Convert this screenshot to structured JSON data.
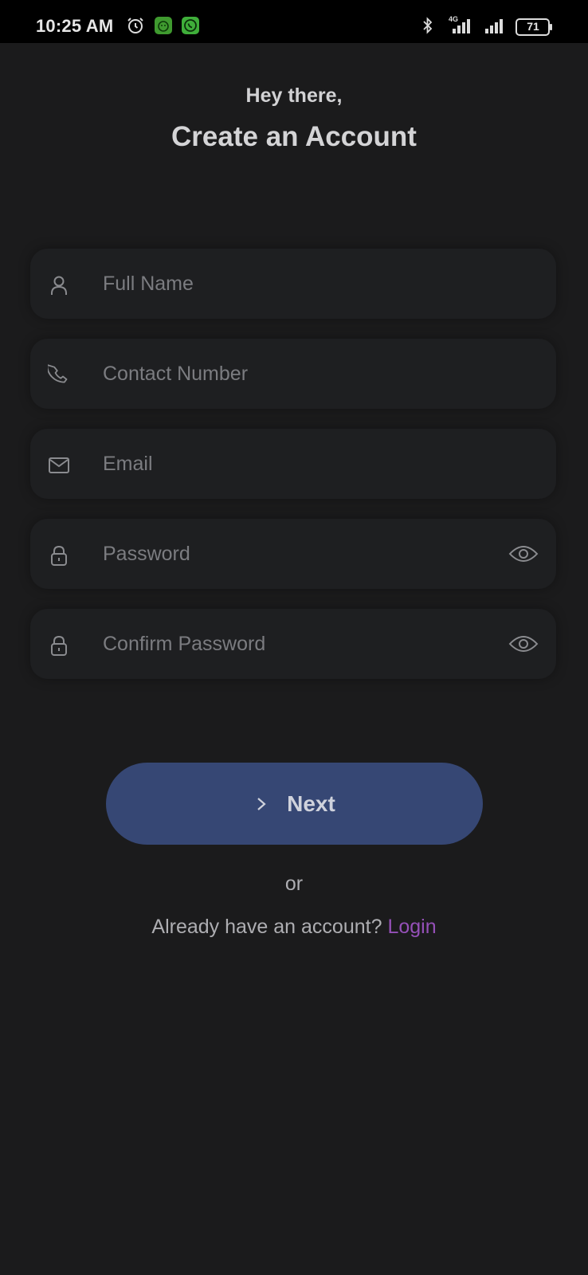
{
  "status_bar": {
    "time": "10:25 AM",
    "network": "4G",
    "battery": "71",
    "icons": [
      "alarm-icon",
      "app-notification-icon",
      "whatsapp-icon",
      "bluetooth-icon",
      "signal-icon",
      "signal-icon",
      "battery-icon"
    ]
  },
  "header": {
    "greeting": "Hey there,",
    "title": "Create an Account"
  },
  "form": {
    "full_name": {
      "placeholder": "Full Name",
      "icon": "person-icon"
    },
    "contact_number": {
      "placeholder": "Contact Number",
      "icon": "phone-icon"
    },
    "email": {
      "placeholder": "Email",
      "icon": "mail-icon"
    },
    "password": {
      "placeholder": "Password",
      "icon": "lock-icon",
      "toggle_icon": "eye-icon"
    },
    "confirm_password": {
      "placeholder": "Confirm Password",
      "icon": "lock-icon",
      "toggle_icon": "eye-icon"
    }
  },
  "actions": {
    "next_label": "Next",
    "or_label": "or",
    "login_prompt": "Already have an account?",
    "login_link": "Login"
  },
  "colors": {
    "background": "#1b1b1c",
    "field_background": "#1e1f21",
    "primary_button": "#364774",
    "link": "#9550b8"
  }
}
